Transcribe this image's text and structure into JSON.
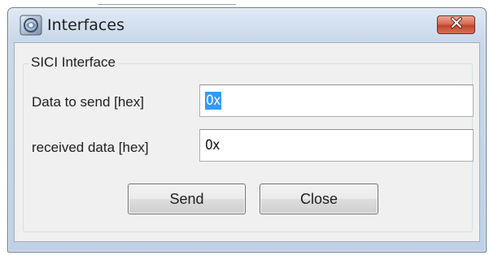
{
  "window": {
    "title": "Interfaces",
    "close_icon": "close-x-icon",
    "app_icon": "interfaces-app-icon"
  },
  "group": {
    "legend": "SICI Interface"
  },
  "fields": {
    "send": {
      "label": "Data to send [hex]",
      "value": "0x"
    },
    "received": {
      "label": "received data [hex]",
      "value": "0x"
    }
  },
  "buttons": {
    "send_label": "Send",
    "close_label": "Close"
  },
  "colors": {
    "selection": "#3399ff",
    "title_close_button": "#c9563f",
    "window_frame": "#c9d8ea"
  }
}
